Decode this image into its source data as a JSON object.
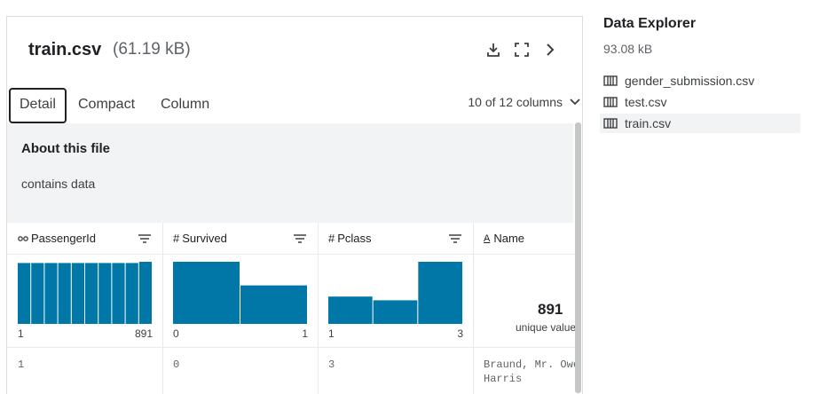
{
  "file": {
    "name": "train.csv",
    "size": "(61.19 kB)"
  },
  "tabs": [
    "Detail",
    "Compact",
    "Column"
  ],
  "column_selector": "10 of 12 columns",
  "about": {
    "title": "About this file",
    "text": "contains data"
  },
  "columns": [
    {
      "name": "PassengerId",
      "type_icon": "id-icon",
      "min": "1",
      "max": "891",
      "first_value": "1",
      "hist": [
        1,
        1,
        1,
        1,
        1,
        1,
        1,
        1,
        1,
        1.02
      ]
    },
    {
      "name": "Survived",
      "type_icon": "hash-icon",
      "min": "0",
      "max": "1",
      "first_value": "0",
      "hist": [
        1,
        0.62
      ]
    },
    {
      "name": "Pclass",
      "type_icon": "hash-icon",
      "min": "1",
      "max": "3",
      "first_value": "3",
      "hist": [
        0.44,
        0.38,
        1
      ]
    },
    {
      "name": "Name",
      "type_icon": "text-icon",
      "unique_count": "891",
      "unique_label": "unique values",
      "first_value": "Braund, Mr. Owen\nHarris"
    }
  ],
  "explorer": {
    "title": "Data Explorer",
    "size": "93.08 kB",
    "files": [
      "gender_submission.csv",
      "test.csv",
      "train.csv"
    ],
    "selected": "train.csv"
  },
  "colors": {
    "bar": "#0077a6",
    "text": "#202124",
    "muted": "#5f6368",
    "bg_about": "#f1f3f4"
  }
}
